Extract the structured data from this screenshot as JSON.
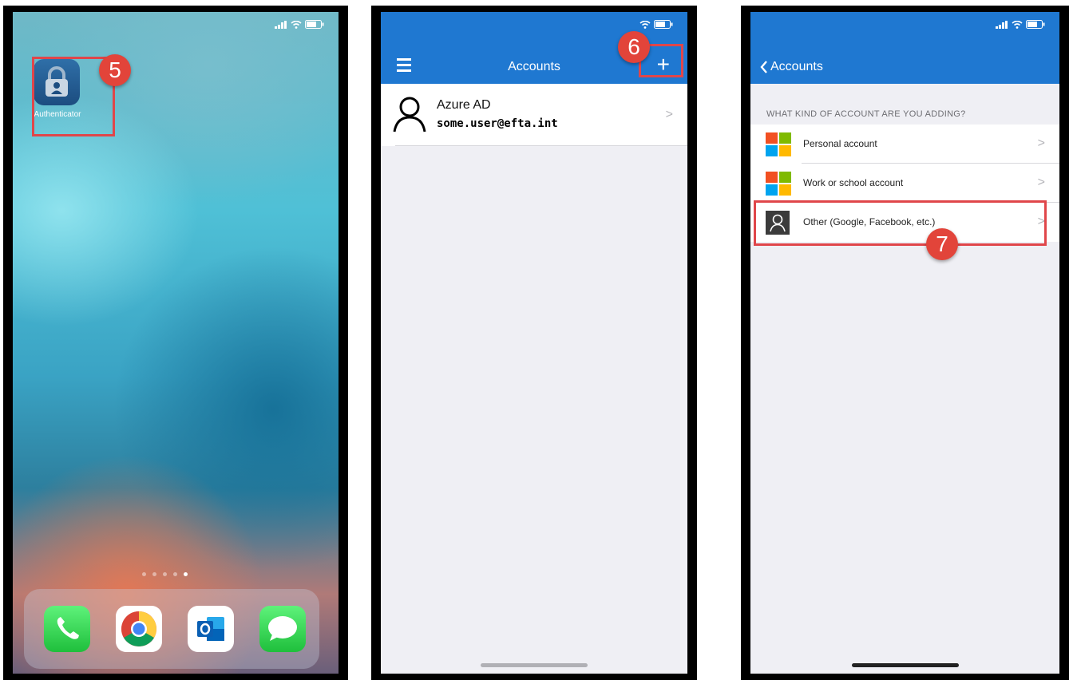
{
  "step_badges": {
    "step5": "5",
    "step6": "6",
    "step7": "7"
  },
  "phone1": {
    "app_label": "Authenticator",
    "page_dots": 5,
    "dock_icons": [
      "phone-icon",
      "chrome-icon",
      "outlook-icon",
      "messages-icon"
    ]
  },
  "phone2": {
    "title": "Accounts",
    "account": {
      "name": "Azure AD",
      "email": "some.user@efta.int"
    },
    "chevron": ">"
  },
  "phone3": {
    "back_label": "Accounts",
    "section_header": "WHAT KIND OF ACCOUNT ARE YOU ADDING?",
    "options": [
      {
        "label": "Personal account",
        "icon": "microsoft-logo-icon"
      },
      {
        "label": "Work or school account",
        "icon": "microsoft-logo-icon"
      },
      {
        "label": "Other (Google, Facebook, etc.)",
        "icon": "person-icon"
      }
    ],
    "chevron": ">"
  },
  "colors": {
    "header_blue": "#1f78d1",
    "highlight_red": "#e0464a",
    "badge_red": "#e2443a",
    "ms_red": "#f25022",
    "ms_green": "#7fba00",
    "ms_blue": "#00a4ef",
    "ms_yellow": "#ffb900"
  }
}
